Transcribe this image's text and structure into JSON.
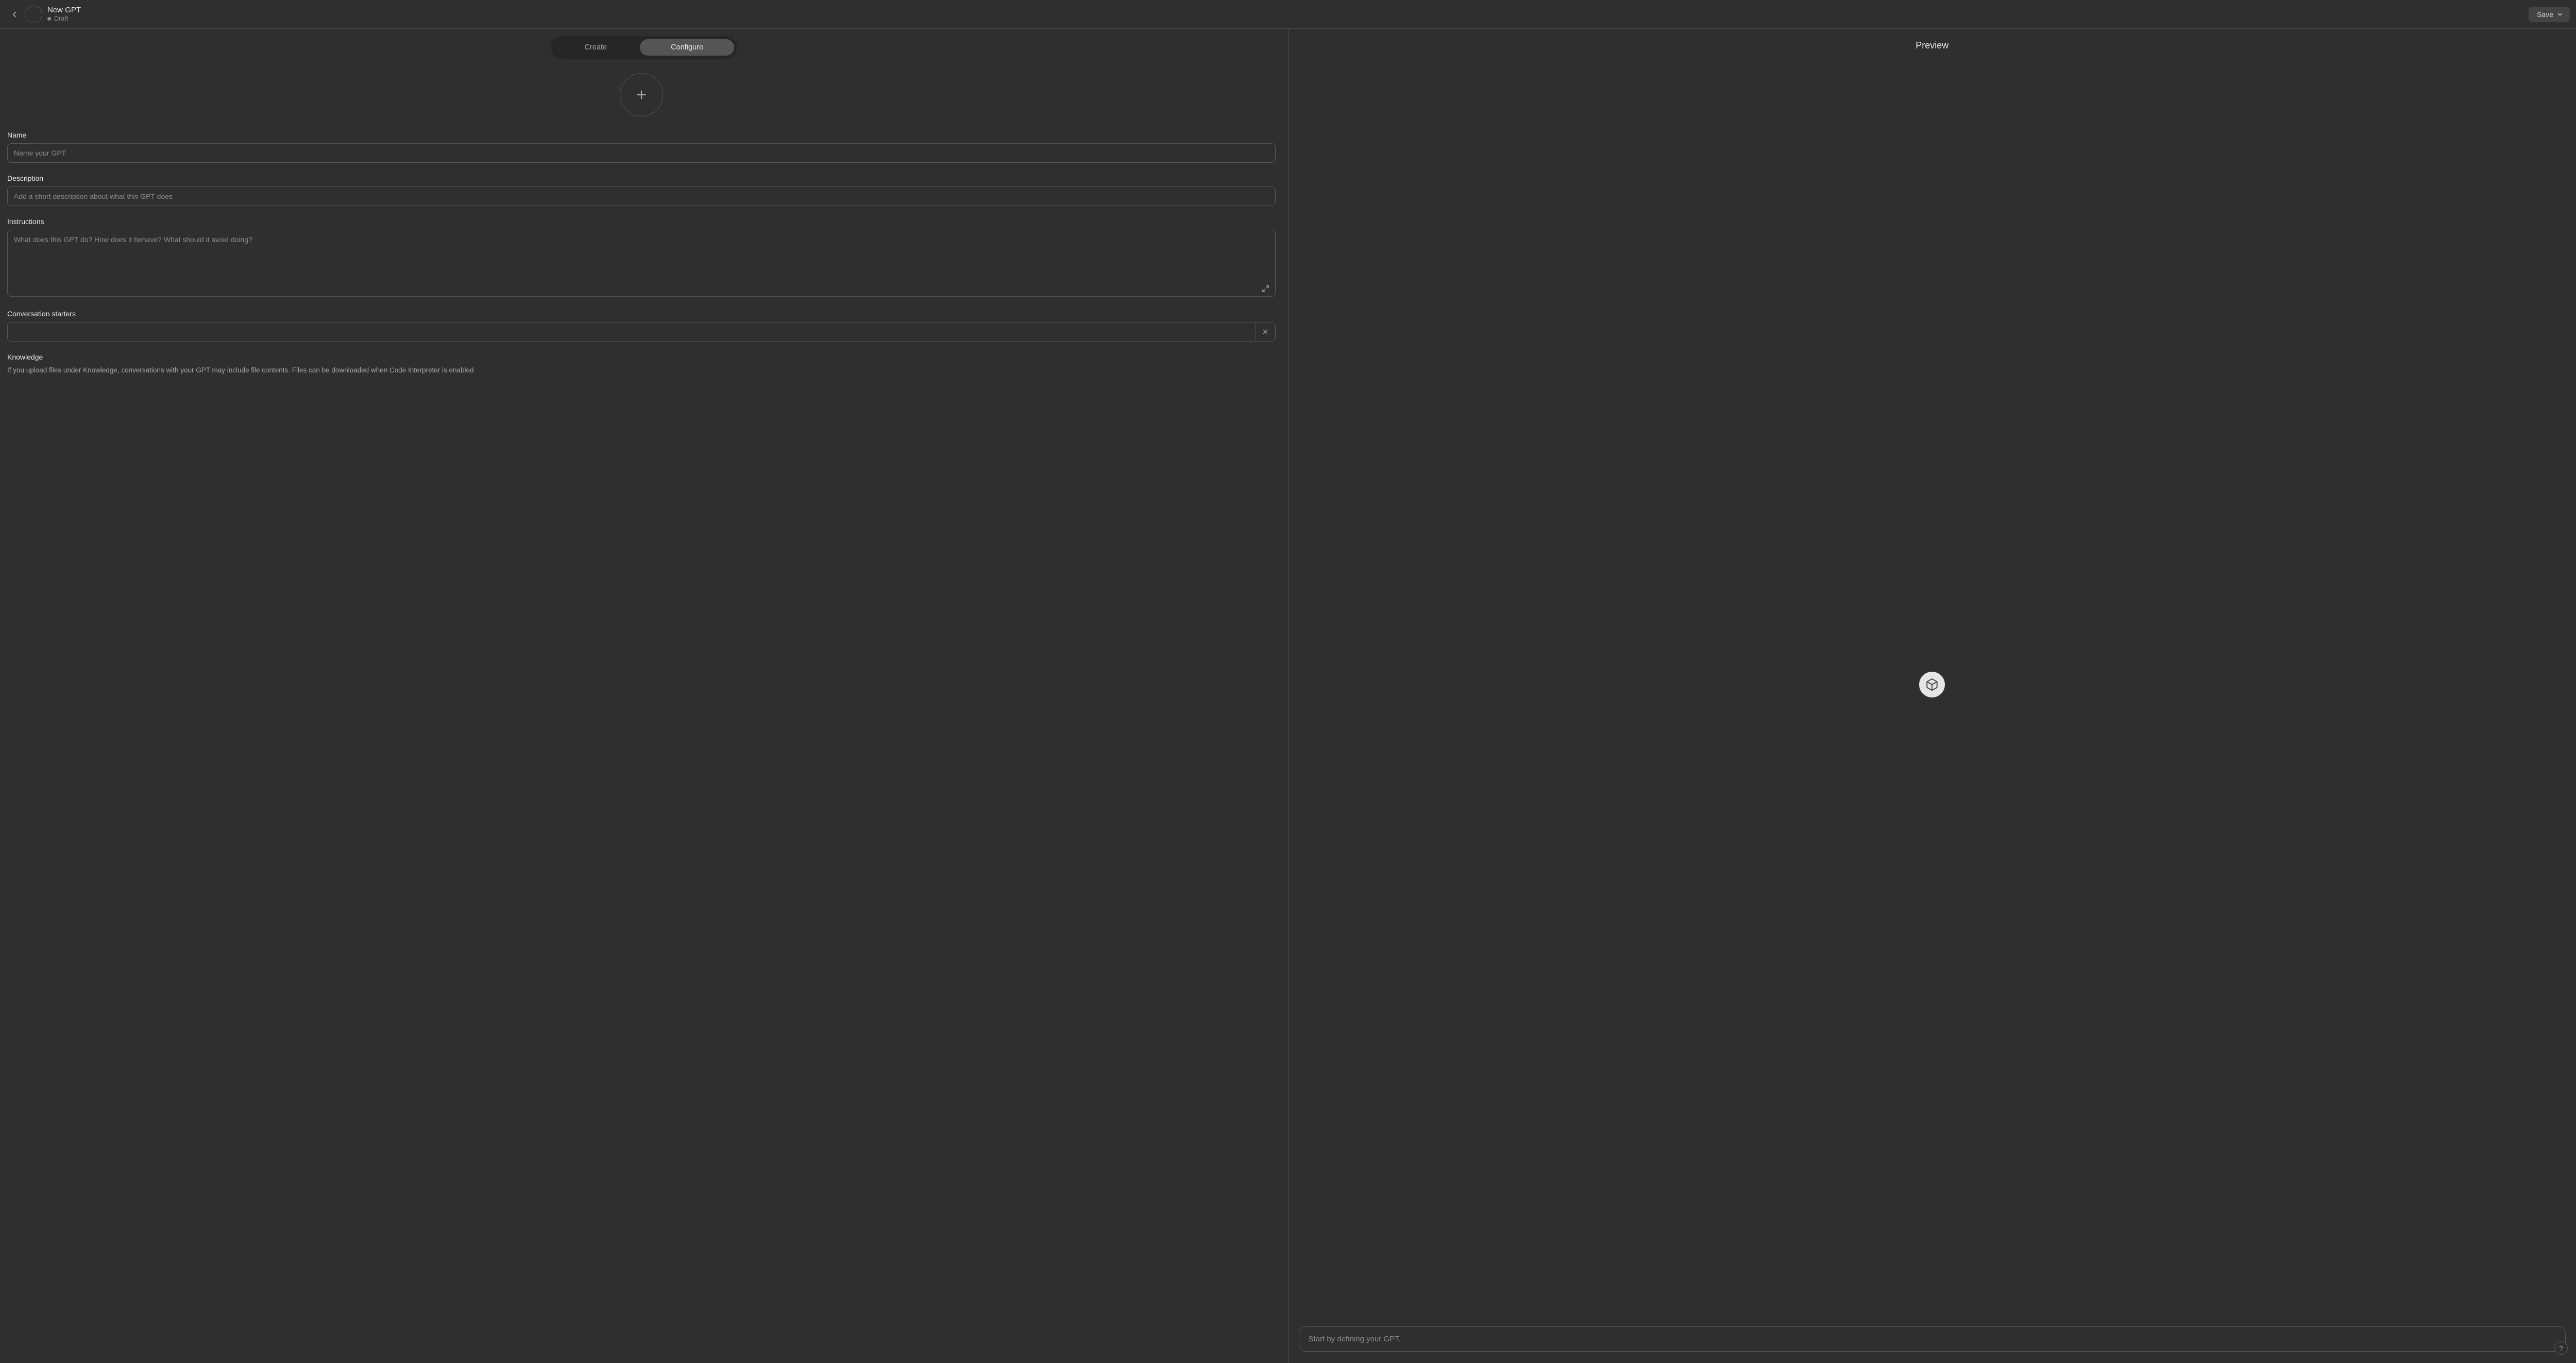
{
  "header": {
    "title": "New GPT",
    "status": "Draft",
    "save_label": "Save"
  },
  "tabs": {
    "create_label": "Create",
    "configure_label": "Configure",
    "active": "configure"
  },
  "form": {
    "name": {
      "label": "Name",
      "placeholder": "Name your GPT",
      "value": ""
    },
    "description": {
      "label": "Description",
      "placeholder": "Add a short description about what this GPT does",
      "value": ""
    },
    "instructions": {
      "label": "Instructions",
      "placeholder": "What does this GPT do? How does it behave? What should it avoid doing?",
      "value": ""
    },
    "starters": {
      "label": "Conversation starters",
      "items": [
        {
          "value": ""
        }
      ]
    },
    "knowledge": {
      "label": "Knowledge",
      "helper": "If you upload files under Knowledge, conversations with your GPT may include file contents. Files can be downloaded when Code Interpreter is enabled"
    }
  },
  "preview": {
    "heading": "Preview",
    "input_placeholder": "Start by defining your GPT."
  },
  "help": {
    "label": "?"
  }
}
